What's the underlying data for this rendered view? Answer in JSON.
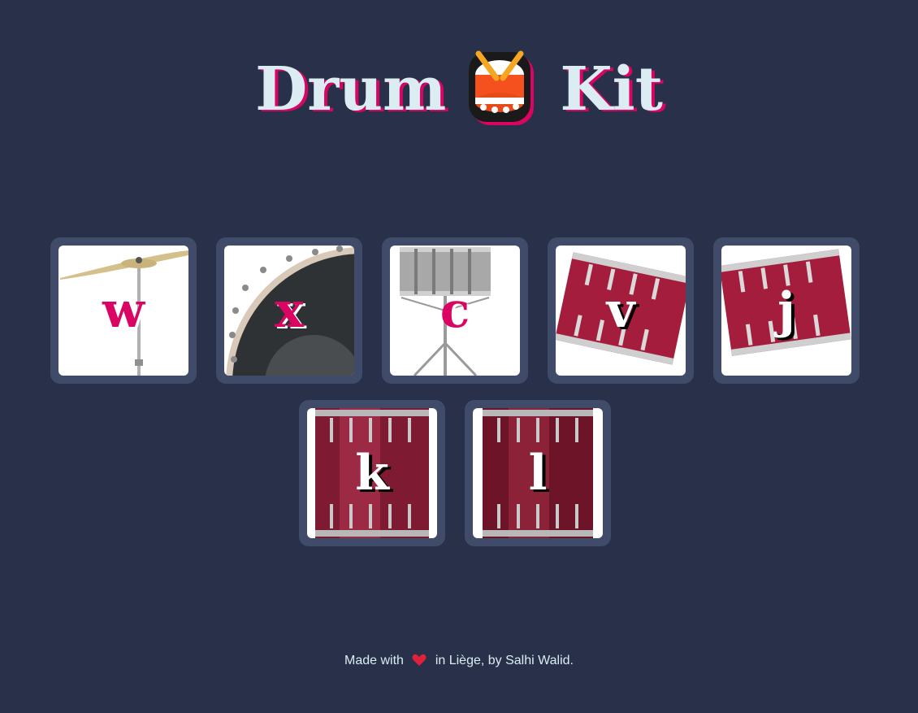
{
  "header": {
    "title_left": "Drum",
    "title_icon": "drum-icon",
    "title_right": "Kit"
  },
  "pads": [
    {
      "key": "w",
      "instrument": "cymbal",
      "icon": "cymbal-icon"
    },
    {
      "key": "x",
      "instrument": "bass-drum",
      "icon": "bass-drum-icon"
    },
    {
      "key": "c",
      "instrument": "snare",
      "icon": "snare-icon"
    },
    {
      "key": "v",
      "instrument": "tom",
      "icon": "tom-icon"
    },
    {
      "key": "j",
      "instrument": "tom",
      "icon": "tom-icon"
    },
    {
      "key": "k",
      "instrument": "floor-tom",
      "icon": "floor-tom-icon"
    },
    {
      "key": "l",
      "instrument": "floor-tom",
      "icon": "floor-tom-icon"
    }
  ],
  "footer": {
    "prefix": "Made with",
    "icon": "heart-icon",
    "suffix": "in Liège, by Salhi Walid."
  },
  "colors": {
    "background": "#283149",
    "pad": "#404B69",
    "accent": "#DA0463",
    "text": "#DBEDF3"
  }
}
